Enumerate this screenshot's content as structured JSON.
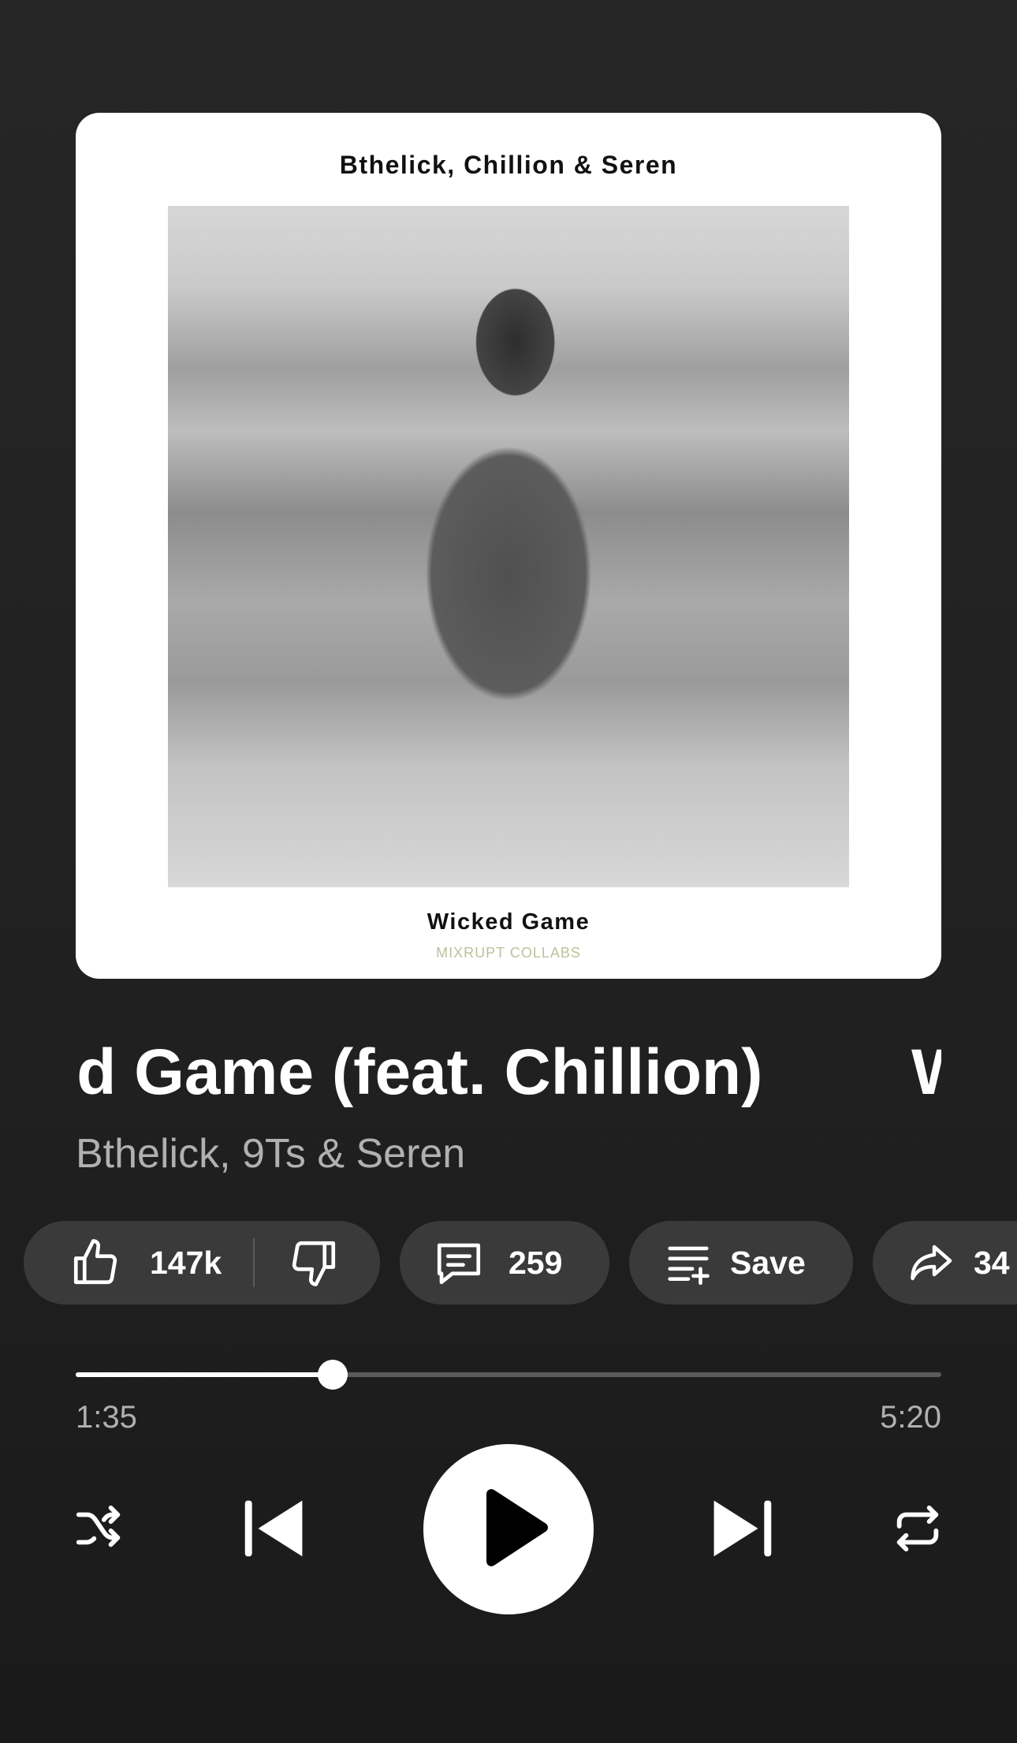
{
  "artwork": {
    "top_text": "Bthelick, Chillion & Seren",
    "bottom_text": "Wicked Game",
    "logo_text": "MIXRUPT COLLABS"
  },
  "track": {
    "title": "Wicked Game (feat. Chillion)",
    "title_repeat_fragment": "W",
    "artists": "Bthelick, 9Ts & Seren"
  },
  "actions": {
    "like_count": "147k",
    "comment_count": "259",
    "save_label": "Save",
    "share_count": "34"
  },
  "progress": {
    "elapsed": "1:35",
    "duration": "5:20",
    "fraction": 0.297
  },
  "controls": {
    "shuffle_icon": "shuffle-icon",
    "previous_icon": "skip-previous-icon",
    "play_icon": "play-icon",
    "next_icon": "skip-next-icon",
    "repeat_icon": "repeat-icon"
  }
}
